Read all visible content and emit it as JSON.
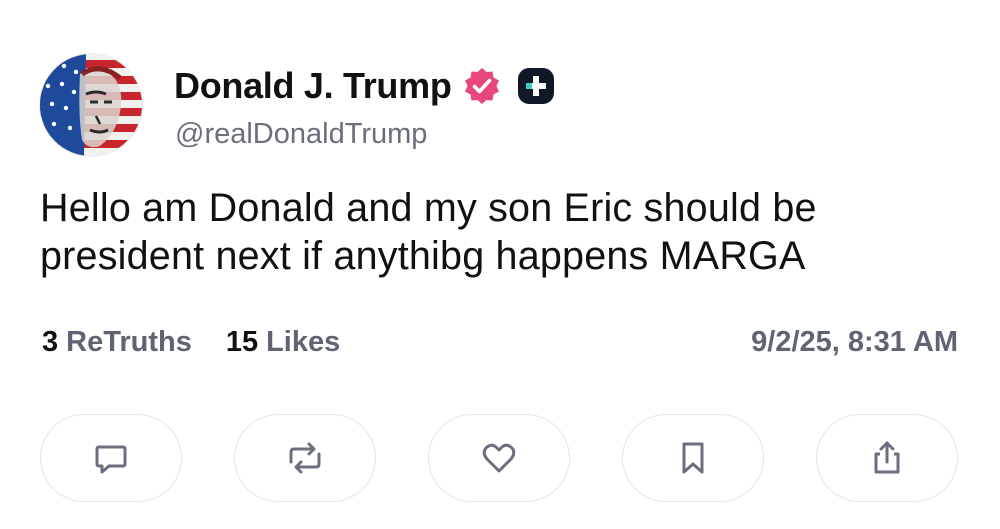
{
  "post": {
    "author": {
      "display_name": "Donald J. Trump",
      "handle": "@realDonaldTrump",
      "avatar_icon": "flag-portrait-avatar",
      "verified_badge_icon": "verified-badge-icon",
      "verified_badge_color": "#e8477e",
      "plus_badge_icon": "plus-badge-icon",
      "plus_badge_color": "#111827"
    },
    "text": "Hello am Donald and my son Eric should be president next if anythibg happens MARGA",
    "stats": {
      "retruths_count": "3",
      "retruths_label": "ReTruths",
      "likes_count": "15",
      "likes_label": "Likes"
    },
    "timestamp": "9/2/25, 8:31 AM",
    "actions": [
      {
        "name": "reply-button",
        "icon": "comment-icon"
      },
      {
        "name": "retruth-button",
        "icon": "repost-icon"
      },
      {
        "name": "like-button",
        "icon": "heart-icon"
      },
      {
        "name": "bookmark-button",
        "icon": "bookmark-icon"
      },
      {
        "name": "share-button",
        "icon": "share-icon"
      }
    ],
    "colors": {
      "text_primary": "#111111",
      "text_secondary": "#5f6473",
      "icon_gray": "#6b6f7d",
      "button_border": "#e4e5ea"
    }
  }
}
